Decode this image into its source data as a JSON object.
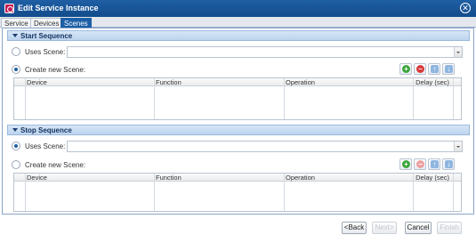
{
  "window": {
    "title": "Edit Service Instance"
  },
  "tabs": [
    {
      "label": "Service",
      "active": false
    },
    {
      "label": "Devices",
      "active": false
    },
    {
      "label": "Scenes",
      "active": true
    }
  ],
  "start_sequence": {
    "header": "Start Sequence",
    "uses_scene_label": "Uses Scene:",
    "uses_scene_selected": false,
    "uses_scene_value": "",
    "create_new_label": "Create new Scene:",
    "create_new_selected": true,
    "columns": [
      "Device",
      "Function",
      "Operation",
      "Delay (sec)"
    ],
    "rows": []
  },
  "stop_sequence": {
    "header": "Stop Sequence",
    "uses_scene_label": "Uses Scene:",
    "uses_scene_selected": true,
    "uses_scene_value": "",
    "create_new_label": "Create new Scene:",
    "create_new_selected": false,
    "columns": [
      "Device",
      "Function",
      "Operation",
      "Delay (sec)"
    ],
    "rows": []
  },
  "footer": {
    "back_label": "<Back",
    "next_label": "Next>",
    "cancel_label": "Cancel",
    "finish_label": "Finish"
  },
  "colors": {
    "titlebar": "#1f5fa3",
    "active_tab": "#1c5fa6",
    "section_header": "#c8dcf2"
  }
}
